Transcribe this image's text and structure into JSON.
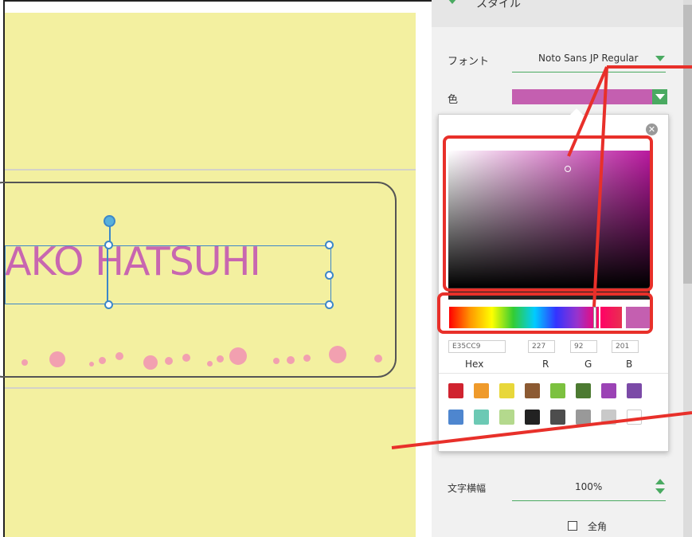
{
  "canvas": {
    "label_text": "AKO HATSUHI",
    "text_color": "#c866b0",
    "background_color": "#f3f0a0"
  },
  "panel": {
    "section_title": "スタイル",
    "font_label": "フォント",
    "font_value": "Noto Sans JP Regular",
    "color_label": "色",
    "selected_color": "#c45fb0",
    "width_label": "文字横幅",
    "width_value": "100%",
    "fullwidth_label": "全角"
  },
  "color_picker": {
    "hex_value": "E35CC9",
    "r_value": "227",
    "g_value": "92",
    "b_value": "201",
    "hex_label": "Hex",
    "r_label": "R",
    "g_label": "G",
    "b_label": "B",
    "hue_color": "#ba1aa0",
    "palette": [
      "#d0232f",
      "#ef9a2b",
      "#e8d73a",
      "#8c5a32",
      "#7cc13f",
      "#4c7a31",
      "#9b43b5",
      "#7b4aa7",
      "#4e86cf",
      "#6cc9b4",
      "#b4d98d",
      "#222222",
      "#4d4d4d",
      "#999999",
      "#c9c9c9",
      "#ffffff"
    ]
  },
  "annotation": {
    "highlight_color": "#e8302a"
  }
}
